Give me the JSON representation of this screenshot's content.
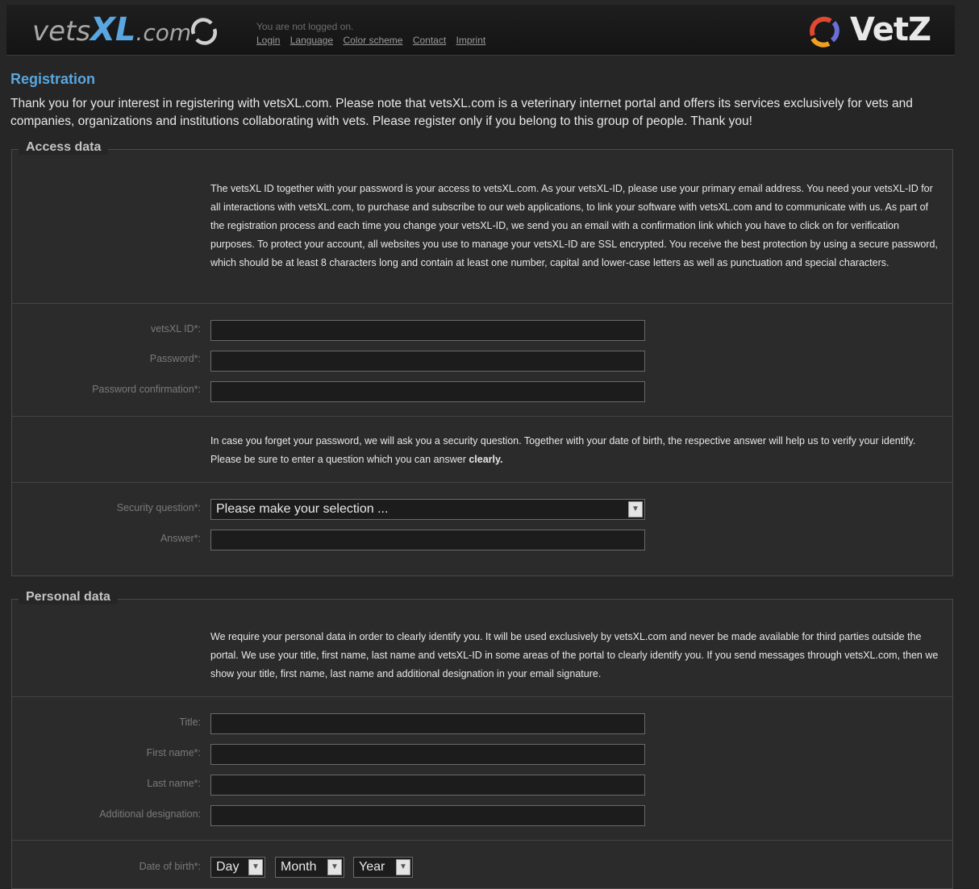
{
  "header": {
    "logo": {
      "part1": "vets",
      "part2": "XL",
      "part3": ".com"
    },
    "status_text": "You are not logged on.",
    "nav": [
      "Login",
      "Language",
      "Color scheme",
      "Contact",
      "Imprint"
    ],
    "brand": "VetZ"
  },
  "page": {
    "title": "Registration",
    "intro": "Thank you for your interest in registering with vetsXL.com. Please note that vetsXL.com is a veterinary internet portal and offers its services exclusively for vets and companies, organizations and institutions collaborating with vets. Please register only if you belong to this group of people. Thank you!"
  },
  "access": {
    "legend": "Access data",
    "description": "The vetsXL ID together with your password is your access to vetsXL.com. As your vetsXL-ID, please use your primary email address. You need your vetsXL-ID for all interactions with vetsXL.com, to purchase and subscribe to our web applications, to link your software with vetsXL.com and to communicate with us. As part of the registration process and each time you change your vetsXL-ID, we send you an email with a confirmation link which you have to click on for verification purposes. To protect your account, all websites you use to manage your vetsXL-ID are SSL encrypted. You receive the best protection by using a secure password, which should be at least 8 characters long and contain at least one number, capital and lower-case letters as well as punctuation and special characters.",
    "labels": {
      "vetsxl_id": "vetsXL ID*:",
      "password": "Password*:",
      "password_confirmation": "Password confirmation*:",
      "security_question": "Security question*:",
      "answer": "Answer*:"
    },
    "security_text": "In case you forget your password, we will ask you a security question. Together with your date of birth, the respective answer will help us to verify your identify. Please be sure to enter a question which you can answer",
    "security_text_bold": "clearly.",
    "security_select": "Please make your selection ..."
  },
  "personal": {
    "legend": "Personal data",
    "description": "We require your personal data in order to clearly identify you. It will be used exclusively by vetsXL.com and never be made available for third parties outside the portal. We use your title, first name, last name and vetsXL-ID in some areas of the portal to clearly identify you. If you send messages through vetsXL.com, then we show your title, first name, last name and additional designation in your email signature.",
    "labels": {
      "title": "Title:",
      "first_name": "First name*:",
      "last_name": "Last name*:",
      "additional_designation": "Additional designation:",
      "date_of_birth": "Date of birth*:"
    },
    "dob": {
      "day": "Day",
      "month": "Month",
      "year": "Year"
    }
  },
  "icons": {
    "dropdown_arrow": "chevron-down-icon",
    "logo_swirl": "swirl-icon"
  },
  "colors": {
    "accent": "#5aa6e0",
    "background": "#262626",
    "panel": "#2b2b2b"
  }
}
